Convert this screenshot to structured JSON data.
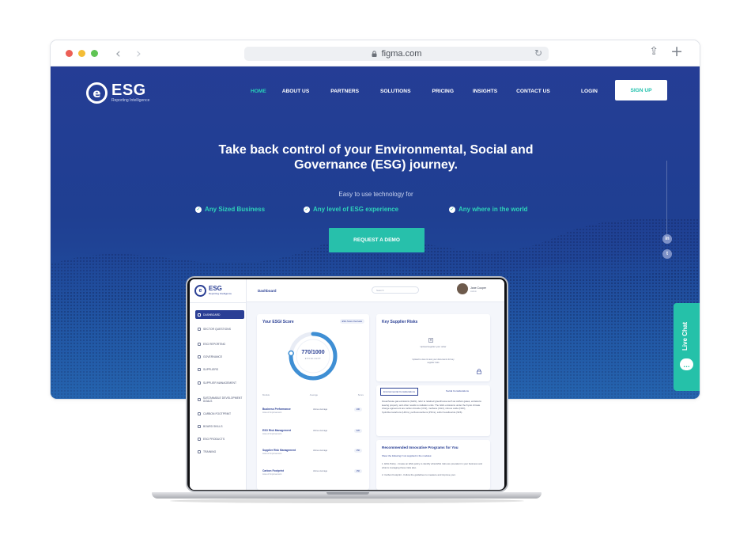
{
  "browser": {
    "url": "figma.com"
  },
  "site": {
    "logo_text": "ESG",
    "logo_sub": "Reporting Intelligence",
    "nav": [
      "HOME",
      "ABOUT US",
      "PARTNERS",
      "SOLUTIONS",
      "PRICING",
      "INSIGHTS",
      "CONTACT US"
    ],
    "login": "LOGIN",
    "signup": "SIGN UP",
    "hero_title_1": "Take back control of your Environmental, Social and",
    "hero_title_2": "Governance (ESG) journey.",
    "hero_sub": "Easy to use technology for",
    "features": [
      "Any Sized Business",
      "Any level of ESG experience",
      "Any where in the world"
    ],
    "cta": "REQUEST A DEMO",
    "social": [
      "in",
      "t"
    ],
    "live_chat": "Live Chat",
    "accent": "#27c0ab"
  },
  "dashboard": {
    "logo_text": "ESG",
    "logo_sub": "Reporting Intelligence",
    "title": "Dashboard",
    "search_placeholder": "Search",
    "user_name": "Jane Cooper",
    "user_role": "Admin",
    "sidebar": [
      "DASHBOARD",
      "SECTOR QUESTIONS",
      "ESG REPORTING",
      "GOVERNANCE",
      "SUPPLIERS",
      "SUPPLIER MANAGEMENT",
      "SUSTAINABLE DEVELOPMENT GOALS",
      "CARBON FOOTPRINT",
      "BOARD SKILLS",
      "ESG PRODUCTS",
      "TRAINING"
    ],
    "score_title": "Your ESGI Score",
    "score_pill": "ESG Score Overview",
    "score_value": "770/1000",
    "score_label": "EXCELLENT",
    "score_fraction": 0.77,
    "table_headers": [
      "Module",
      "Average",
      "Score"
    ],
    "rows": [
      {
        "name": "Business Performance",
        "sub": "Area of Improvement",
        "avg": "Above Average",
        "score": "100"
      },
      {
        "name": "ESG Risk Management",
        "sub": "Area of Improvement",
        "avg": "Above Average",
        "score": "220"
      },
      {
        "name": "Supplier Risk Management",
        "sub": "Area of Improvement",
        "avg": "Above Average",
        "score": "150"
      },
      {
        "name": "Carbon Footprint",
        "sub": "Area of Improvement",
        "avg": "Above Average",
        "score": "150"
      }
    ],
    "risk_title": "Key Supplier Risks",
    "risk_msg": "Upload supplier your order",
    "risk_msg2": "Upload to view & view your documents for key supplier risks",
    "tabs": [
      "Environmental Considerations",
      "Social Considerations"
    ],
    "env_text": "Greenhouse gas emissions (GHG), refer to retained greenhouse such as carbon gases, emissions leaving property, and other results to radiation units. The GHG emissions under the Kyoto climate change agreement are carbon dioxide (CO2), methane (CH4), nitrous oxide (N2O), hydrofluorocarbons (HFCs), perfluorocarbons (PFCs), sulfur hexafluoride (SF6).",
    "rec_title": "Recommended Innovative Programs for You",
    "rec_sub": "Show the following if not supplied in the modules:",
    "rec_items": [
      "1. ESG Policy - Create an ESG policy to identify what ESG risks are prevalent in your business and what is managing these risks also.",
      "2. Carbon Footprint - Follow the guidelines to measure and improve your."
    ]
  }
}
